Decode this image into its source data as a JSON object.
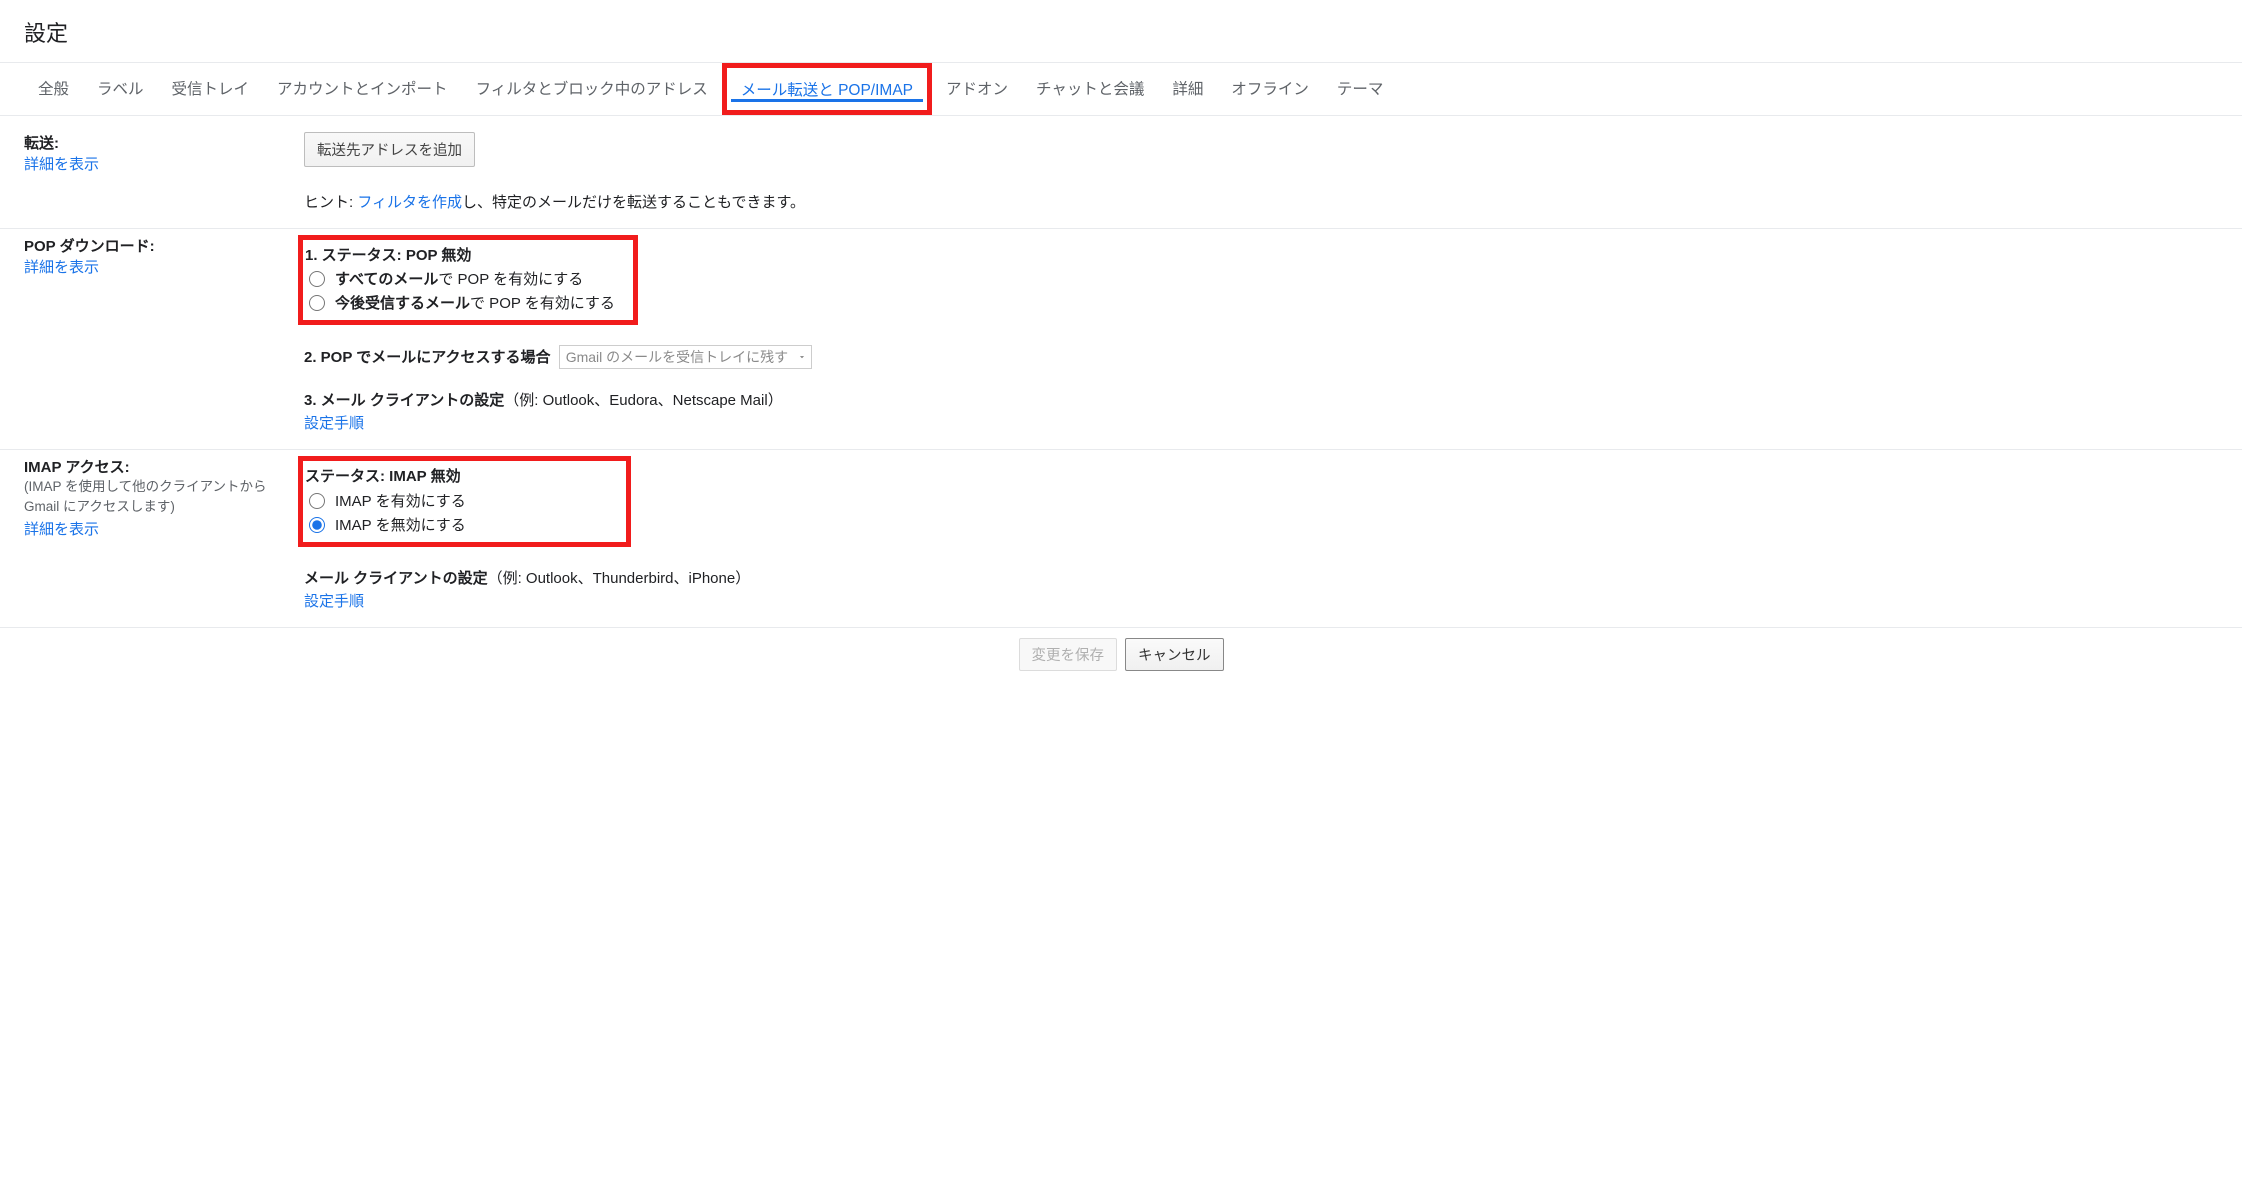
{
  "page_title": "設定",
  "tabs": [
    "全般",
    "ラベル",
    "受信トレイ",
    "アカウントとインポート",
    "フィルタとブロック中のアドレス",
    "メール転送と POP/IMAP",
    "アドオン",
    "チャットと会議",
    "詳細",
    "オフライン",
    "テーマ"
  ],
  "forwarding": {
    "label": "転送:",
    "learn_more": "詳細を表示",
    "add_button": "転送先アドレスを追加",
    "hint_prefix": "ヒント: ",
    "hint_link": "フィルタを作成",
    "hint_suffix": "し、特定のメールだけを転送することもできます。"
  },
  "pop": {
    "label": "POP ダウンロード:",
    "learn_more": "詳細を表示",
    "status_label": "1. ステータス: ",
    "status_value": "POP 無効",
    "opt1_bold": "すべてのメール",
    "opt1_suffix": "で POP を有効にする",
    "opt2_bold": "今後受信するメール",
    "opt2_suffix": "で POP を有効にする",
    "step2_label": "2. POP でメールにアクセスする場合",
    "step2_select": "Gmail のメールを受信トレイに残す",
    "step3_label": "3. メール クライアントの設定",
    "step3_examples": "（例: Outlook、Eudora、Netscape Mail）",
    "config_link": "設定手順"
  },
  "imap": {
    "label": "IMAP アクセス:",
    "desc": "(IMAP を使用して他のクライアントから Gmail にアクセスします)",
    "learn_more": "詳細を表示",
    "status_label": "ステータス: ",
    "status_value": "IMAP 無効",
    "opt_enable": "IMAP を有効にする",
    "opt_disable": "IMAP を無効にする",
    "client_label": "メール クライアントの設定",
    "client_examples": "（例: Outlook、Thunderbird、iPhone）",
    "config_link": "設定手順"
  },
  "footer": {
    "save": "変更を保存",
    "cancel": "キャンセル"
  }
}
